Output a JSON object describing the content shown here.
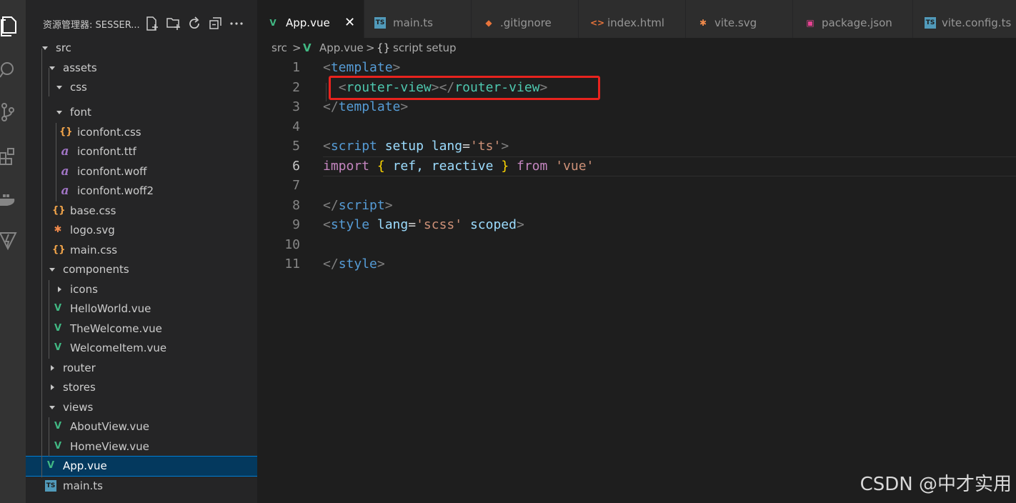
{
  "sidebar": {
    "title": "资源管理器: SESSER...",
    "tree": [
      {
        "label": "src",
        "type": "folder-open"
      },
      {
        "label": "assets",
        "type": "folder-open"
      },
      {
        "label": "css",
        "type": "folder-open"
      },
      {
        "label": "font",
        "type": "folder-open"
      },
      {
        "label": "iconfont.css",
        "type": "css"
      },
      {
        "label": "iconfont.ttf",
        "type": "font"
      },
      {
        "label": "iconfont.woff",
        "type": "font"
      },
      {
        "label": "iconfont.woff2",
        "type": "font"
      },
      {
        "label": "base.css",
        "type": "css"
      },
      {
        "label": "logo.svg",
        "type": "svg"
      },
      {
        "label": "main.css",
        "type": "css"
      },
      {
        "label": "components",
        "type": "folder-open"
      },
      {
        "label": "icons",
        "type": "folder-closed"
      },
      {
        "label": "HelloWorld.vue",
        "type": "vue"
      },
      {
        "label": "TheWelcome.vue",
        "type": "vue"
      },
      {
        "label": "WelcomeItem.vue",
        "type": "vue"
      },
      {
        "label": "router",
        "type": "folder-closed"
      },
      {
        "label": "stores",
        "type": "folder-closed"
      },
      {
        "label": "views",
        "type": "folder-open"
      },
      {
        "label": "AboutView.vue",
        "type": "vue"
      },
      {
        "label": "HomeView.vue",
        "type": "vue"
      },
      {
        "label": "App.vue",
        "type": "vue",
        "selected": true
      },
      {
        "label": "main.ts",
        "type": "ts"
      }
    ]
  },
  "tabs": [
    {
      "label": "App.vue",
      "icon": "V",
      "active": true
    },
    {
      "label": "main.ts",
      "icon": "TS"
    },
    {
      "label": ".gitignore",
      "icon": "git"
    },
    {
      "label": "index.html",
      "icon": "<>"
    },
    {
      "label": "vite.svg",
      "icon": "svg"
    },
    {
      "label": "package.json",
      "icon": "pkg"
    },
    {
      "label": "vite.config.ts",
      "icon": "TS"
    }
  ],
  "breadcrumb": {
    "folder": "src",
    "file": "App.vue",
    "symbol": "script setup",
    "sep": ">",
    "braces": "{}"
  },
  "editor": {
    "line_numbers": [
      "1",
      "2",
      "3",
      "4",
      "5",
      "6",
      "7",
      "8",
      "9",
      "10",
      "11"
    ],
    "current_line": "6",
    "tokens": {
      "tag_open": "<",
      "tag_close": ">",
      "tag_end_open": "</",
      "template": "template",
      "router_view": "router-view",
      "script": "script",
      "setup": "setup",
      "lang": "lang",
      "eq": "=",
      "ts_str": "'ts'",
      "import": "import",
      "lbrace": "{",
      "rbrace": "}",
      "ref": "ref,",
      "reactive": "reactive",
      "from": "from",
      "vue_str": "'vue'",
      "style": "style",
      "scss_str": "'scss'",
      "scoped": "scoped"
    }
  },
  "watermark": "CSDN @中才实用",
  "colors": {
    "accent": "#007fd4",
    "vue_green": "#41b883",
    "ts_blue": "#519aba",
    "highlight_box": "#e8231e"
  }
}
